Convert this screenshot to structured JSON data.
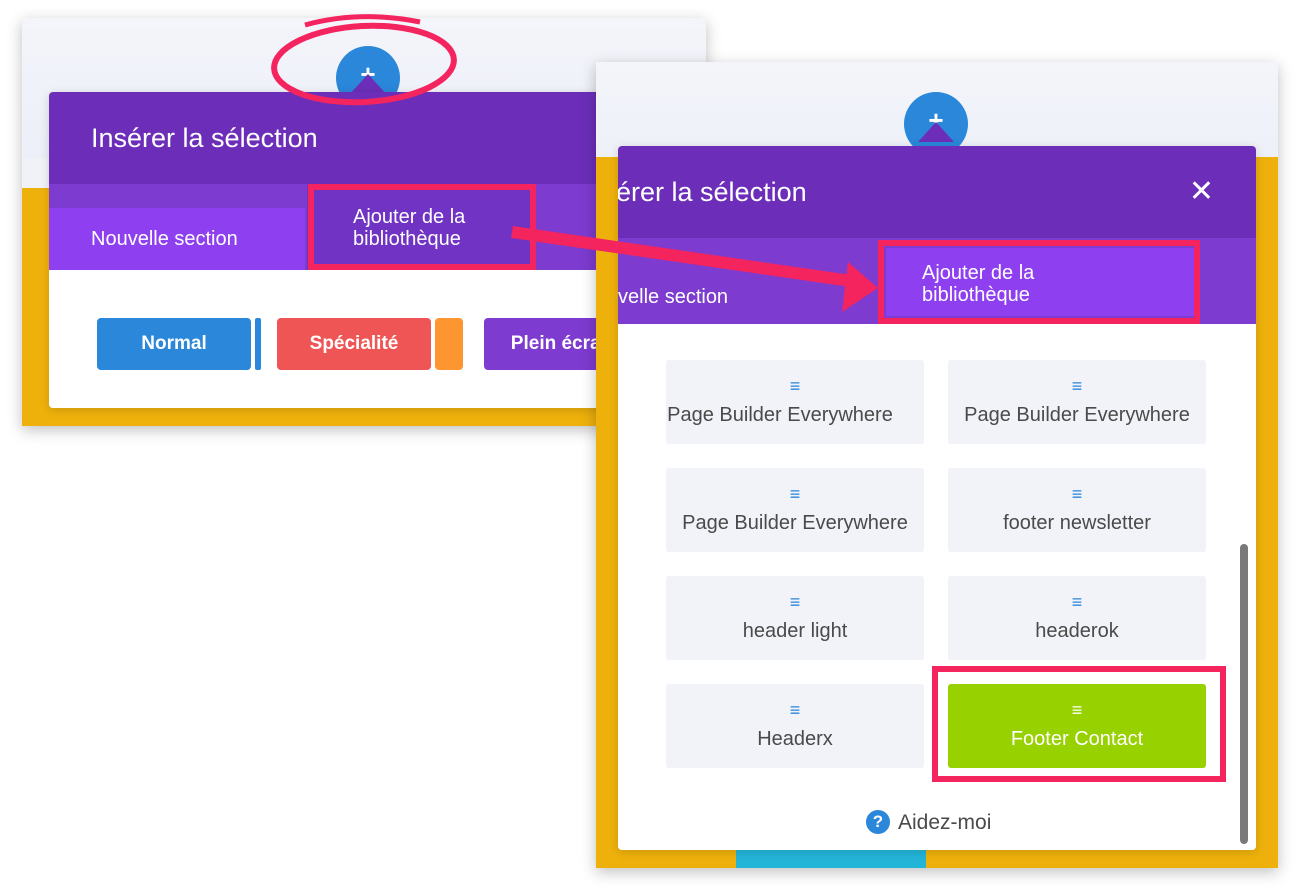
{
  "left_panel": {
    "plus_label": "+",
    "modal_title": "Insérer la sélection",
    "close_label": "✕",
    "tabs": [
      {
        "label": "Nouvelle section"
      },
      {
        "label_line1": "Ajouter de la",
        "label_line2": "bibliothèque"
      }
    ],
    "buttons": [
      {
        "label": "Normal",
        "color": "#2b87da"
      },
      {
        "label": "Spécialité",
        "color": "#ef5555"
      },
      {
        "label": "Plein écran",
        "color": "#7e3bd0"
      }
    ]
  },
  "right_panel": {
    "plus_label": "+",
    "modal_title": "érer la sélection",
    "close_label": "✕",
    "tabs": [
      {
        "label": "velle section"
      },
      {
        "label_line1": "Ajouter de la",
        "label_line2": "bibliothèque"
      }
    ],
    "library_items": [
      {
        "label": "Page Builder Everywhere",
        "icon": "menu-icon"
      },
      {
        "label": "Page Builder Everywhere",
        "icon": "menu-icon"
      },
      {
        "label": "Page Builder Everywhere",
        "icon": "menu-icon"
      },
      {
        "label": "footer newsletter",
        "icon": "menu-icon"
      },
      {
        "label": "header light",
        "icon": "menu-icon"
      },
      {
        "label": "headerok",
        "icon": "menu-icon"
      },
      {
        "label": "Headerx",
        "icon": "menu-icon"
      },
      {
        "label": "Footer Contact",
        "icon": "menu-icon",
        "selected": true
      }
    ],
    "help_label": "Aidez-moi",
    "help_icon": "?"
  },
  "icons": {
    "menu": "≡"
  },
  "colors": {
    "modal_header": "#6c2eb9",
    "tabs_bar": "#7d3bcf",
    "active_tab": "#8e3ff0",
    "selected_item": "#97d100",
    "annotation": "#f4245e",
    "page_yellow": "#eeb10c"
  }
}
